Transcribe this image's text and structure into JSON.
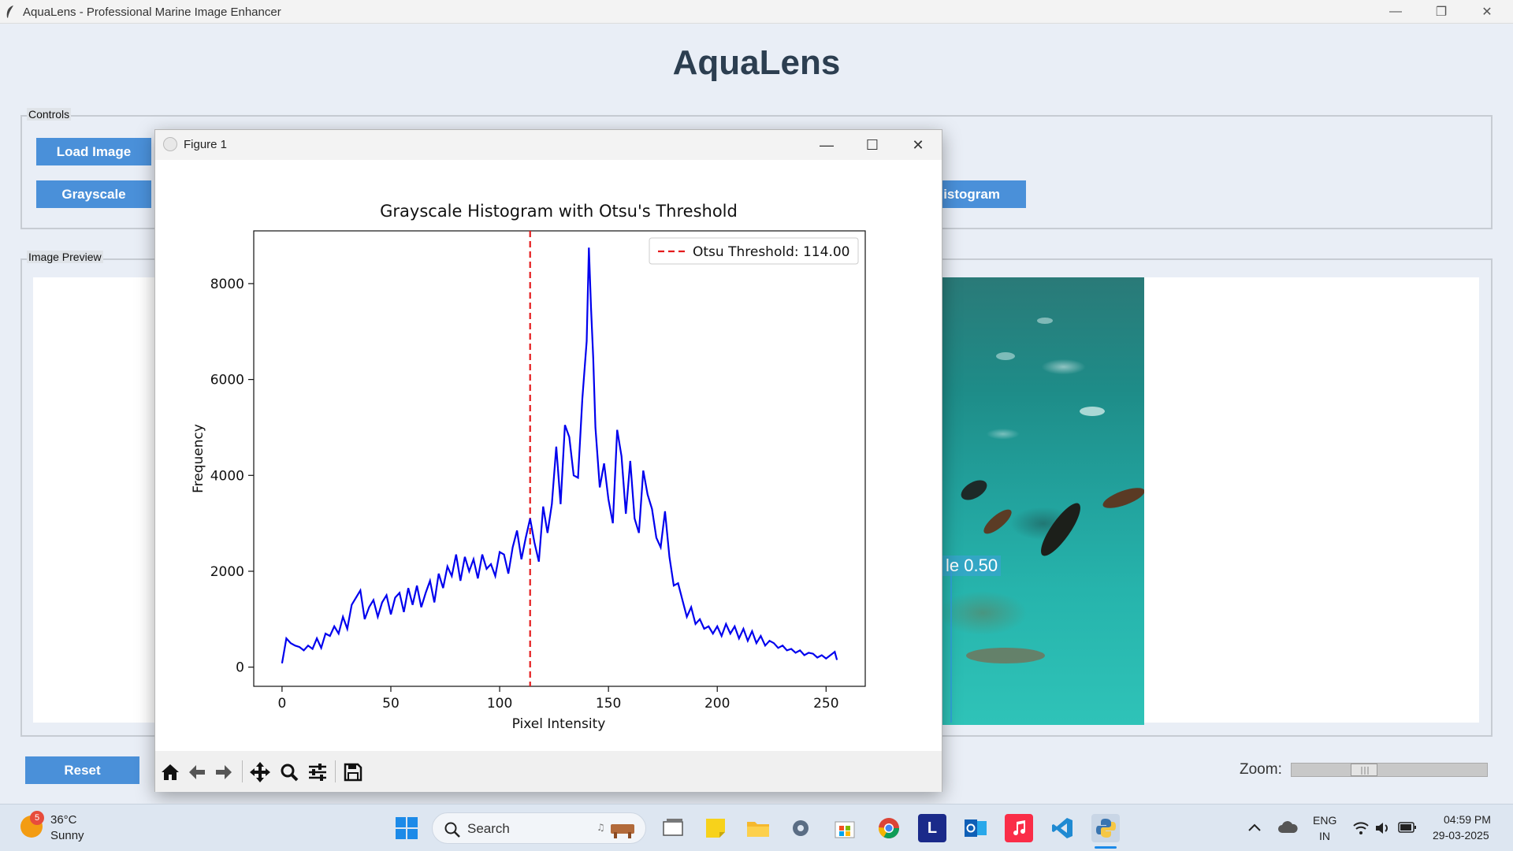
{
  "window": {
    "title": "AquaLens - Professional Marine Image Enhancer",
    "minimize": "—",
    "restore": "❐",
    "close": "✕"
  },
  "app_title": "AquaLens",
  "controls": {
    "label": "Controls",
    "load_image": "Load Image",
    "grayscale": "Grayscale",
    "histogram_partial": "Histogram"
  },
  "preview": {
    "label": "Image Preview",
    "detection_label": "le 0.50"
  },
  "reset_label": "Reset",
  "zoom": {
    "label": "Zoom:",
    "level": 0.35
  },
  "figure": {
    "title": "Figure 1",
    "minimize": "—",
    "maximize": "☐",
    "close": "✕"
  },
  "chart_data": {
    "type": "line",
    "title": "Grayscale Histogram with Otsu's Threshold",
    "xlabel": "Pixel Intensity",
    "ylabel": "Frequency",
    "xlim": [
      -13,
      268
    ],
    "ylim": [
      -400,
      9100
    ],
    "xticks": [
      0,
      50,
      100,
      150,
      200,
      250
    ],
    "yticks": [
      0,
      2000,
      4000,
      6000,
      8000
    ],
    "threshold": {
      "value": 114,
      "label": "Otsu Threshold: 114.00",
      "color": "#e41a1c"
    },
    "legend_position": "top-right",
    "series_color": "#0000ee",
    "points": [
      [
        0,
        80
      ],
      [
        2,
        600
      ],
      [
        4,
        500
      ],
      [
        6,
        450
      ],
      [
        8,
        420
      ],
      [
        10,
        350
      ],
      [
        12,
        450
      ],
      [
        14,
        380
      ],
      [
        16,
        600
      ],
      [
        18,
        400
      ],
      [
        20,
        700
      ],
      [
        22,
        650
      ],
      [
        24,
        850
      ],
      [
        26,
        700
      ],
      [
        28,
        1050
      ],
      [
        30,
        800
      ],
      [
        32,
        1300
      ],
      [
        34,
        1450
      ],
      [
        36,
        1600
      ],
      [
        38,
        1000
      ],
      [
        40,
        1250
      ],
      [
        42,
        1400
      ],
      [
        44,
        1050
      ],
      [
        46,
        1350
      ],
      [
        48,
        1500
      ],
      [
        50,
        1100
      ],
      [
        52,
        1450
      ],
      [
        54,
        1550
      ],
      [
        56,
        1150
      ],
      [
        58,
        1650
      ],
      [
        60,
        1300
      ],
      [
        62,
        1700
      ],
      [
        64,
        1250
      ],
      [
        66,
        1550
      ],
      [
        68,
        1800
      ],
      [
        70,
        1350
      ],
      [
        72,
        1950
      ],
      [
        74,
        1650
      ],
      [
        76,
        2100
      ],
      [
        78,
        1900
      ],
      [
        80,
        2350
      ],
      [
        82,
        1800
      ],
      [
        84,
        2300
      ],
      [
        86,
        2000
      ],
      [
        88,
        2250
      ],
      [
        90,
        1850
      ],
      [
        92,
        2350
      ],
      [
        94,
        2050
      ],
      [
        96,
        2150
      ],
      [
        98,
        1900
      ],
      [
        100,
        2400
      ],
      [
        102,
        2350
      ],
      [
        104,
        1950
      ],
      [
        106,
        2500
      ],
      [
        108,
        2850
      ],
      [
        110,
        2250
      ],
      [
        112,
        2700
      ],
      [
        114,
        3100
      ],
      [
        116,
        2600
      ],
      [
        118,
        2200
      ],
      [
        120,
        3350
      ],
      [
        122,
        2800
      ],
      [
        124,
        3400
      ],
      [
        126,
        4600
      ],
      [
        128,
        3400
      ],
      [
        130,
        5050
      ],
      [
        132,
        4800
      ],
      [
        134,
        4000
      ],
      [
        136,
        3950
      ],
      [
        138,
        5600
      ],
      [
        140,
        6800
      ],
      [
        141,
        8750
      ],
      [
        142,
        7500
      ],
      [
        143,
        6450
      ],
      [
        144,
        5000
      ],
      [
        146,
        3750
      ],
      [
        148,
        4250
      ],
      [
        150,
        3500
      ],
      [
        152,
        3000
      ],
      [
        154,
        4950
      ],
      [
        156,
        4400
      ],
      [
        158,
        3200
      ],
      [
        160,
        4300
      ],
      [
        162,
        3100
      ],
      [
        164,
        2800
      ],
      [
        166,
        4100
      ],
      [
        168,
        3600
      ],
      [
        170,
        3300
      ],
      [
        172,
        2700
      ],
      [
        174,
        2500
      ],
      [
        176,
        3250
      ],
      [
        178,
        2300
      ],
      [
        180,
        1700
      ],
      [
        182,
        1750
      ],
      [
        184,
        1400
      ],
      [
        186,
        1050
      ],
      [
        188,
        1250
      ],
      [
        190,
        900
      ],
      [
        192,
        1000
      ],
      [
        194,
        800
      ],
      [
        196,
        850
      ],
      [
        198,
        700
      ],
      [
        200,
        850
      ],
      [
        202,
        650
      ],
      [
        204,
        900
      ],
      [
        206,
        700
      ],
      [
        208,
        850
      ],
      [
        210,
        600
      ],
      [
        212,
        800
      ],
      [
        214,
        550
      ],
      [
        216,
        750
      ],
      [
        218,
        500
      ],
      [
        220,
        650
      ],
      [
        222,
        450
      ],
      [
        224,
        550
      ],
      [
        226,
        500
      ],
      [
        228,
        400
      ],
      [
        230,
        450
      ],
      [
        232,
        350
      ],
      [
        234,
        380
      ],
      [
        236,
        300
      ],
      [
        238,
        350
      ],
      [
        240,
        250
      ],
      [
        242,
        300
      ],
      [
        244,
        280
      ],
      [
        246,
        200
      ],
      [
        248,
        250
      ],
      [
        250,
        180
      ],
      [
        252,
        250
      ],
      [
        254,
        320
      ],
      [
        255,
        150
      ]
    ]
  },
  "taskbar": {
    "weather_temp": "36°C",
    "weather_desc": "Sunny",
    "weather_badge": "5",
    "search_label": "Search",
    "lang_top": "ENG",
    "lang_bottom": "IN",
    "time": "04:59 PM",
    "date": "29-03-2025",
    "letter_app": "L"
  }
}
